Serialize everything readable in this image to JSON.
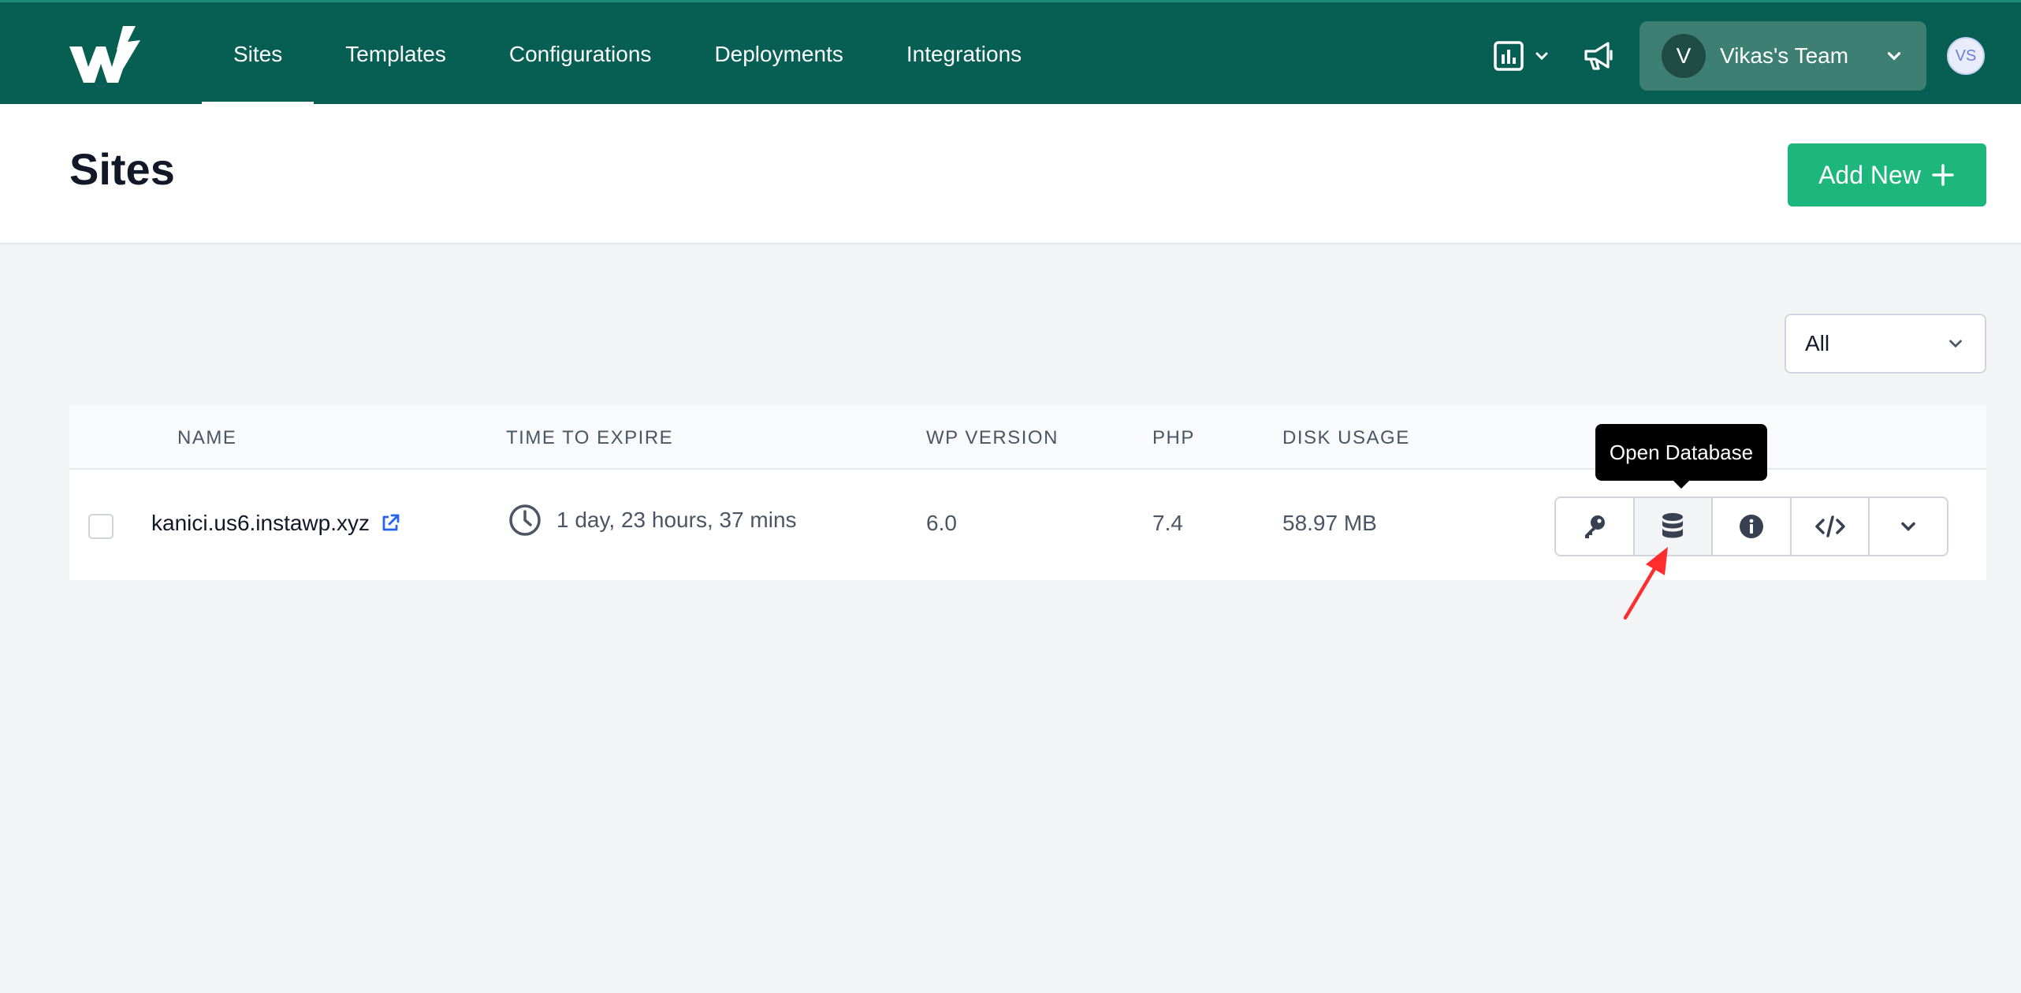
{
  "nav": {
    "items": [
      {
        "label": "Sites",
        "active": true
      },
      {
        "label": "Templates",
        "active": false
      },
      {
        "label": "Configurations",
        "active": false
      },
      {
        "label": "Deployments",
        "active": false
      },
      {
        "label": "Integrations",
        "active": false
      }
    ]
  },
  "header_icons": {
    "analytics": "bar-chart-icon",
    "announcements": "megaphone-icon"
  },
  "team": {
    "initial": "V",
    "name": "Vikas's Team"
  },
  "user": {
    "initials": "VS"
  },
  "page": {
    "title": "Sites",
    "add_new_label": "Add New"
  },
  "filter": {
    "selected": "All"
  },
  "table": {
    "columns": [
      "NAME",
      "TIME TO EXPIRE",
      "WP VERSION",
      "PHP",
      "DISK USAGE"
    ],
    "rows": [
      {
        "name": "kanici.us6.instawp.xyz",
        "time_to_expire": "1 day, 23 hours, 37 mins",
        "wp_version": "6.0",
        "php": "7.4",
        "disk_usage": "58.97 MB"
      }
    ],
    "row_actions": [
      "key-icon",
      "database-icon",
      "info-icon",
      "code-icon",
      "chevron-down-icon"
    ]
  },
  "tooltip": {
    "text": "Open Database"
  },
  "colors": {
    "topbar": "#065f52",
    "accent": "#1db77e",
    "annotation_arrow": "#ff2d2d"
  }
}
